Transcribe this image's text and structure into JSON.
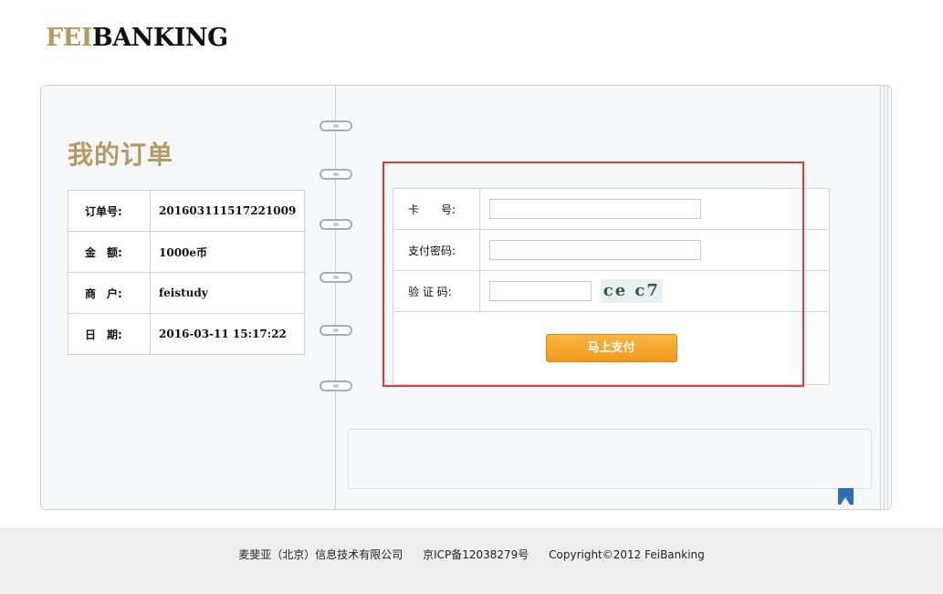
{
  "header": {
    "logo_prefix": "FEI",
    "logo_suffix": "BANKING"
  },
  "order": {
    "title": "我的订单",
    "rows": [
      {
        "label": "订单号:",
        "value": "201603111517221009"
      },
      {
        "label": "金　额:",
        "value": "1000e币"
      },
      {
        "label": "商　户:",
        "value": "feistudy"
      },
      {
        "label": "日　期:",
        "value": "2016-03-11 15:17:22"
      }
    ]
  },
  "payment_form": {
    "card_label": "卡　　号:",
    "card_value": "",
    "password_label": "支付密码:",
    "password_value": "",
    "captcha_label": "验 证 码:",
    "captcha_value": "",
    "captcha_text": "ce c7",
    "submit_label": "马上支付"
  },
  "footer": {
    "company": "麦斐亚（北京）信息技术有限公司",
    "icp": "京ICP备12038279号",
    "copyright": "Copyright©2012 FeiBanking"
  },
  "colors": {
    "brand_gold": "#b59a64",
    "button_orange": "#ef9a1c",
    "highlight_red": "#e53935",
    "bookmark_blue": "#2d6fb6"
  }
}
